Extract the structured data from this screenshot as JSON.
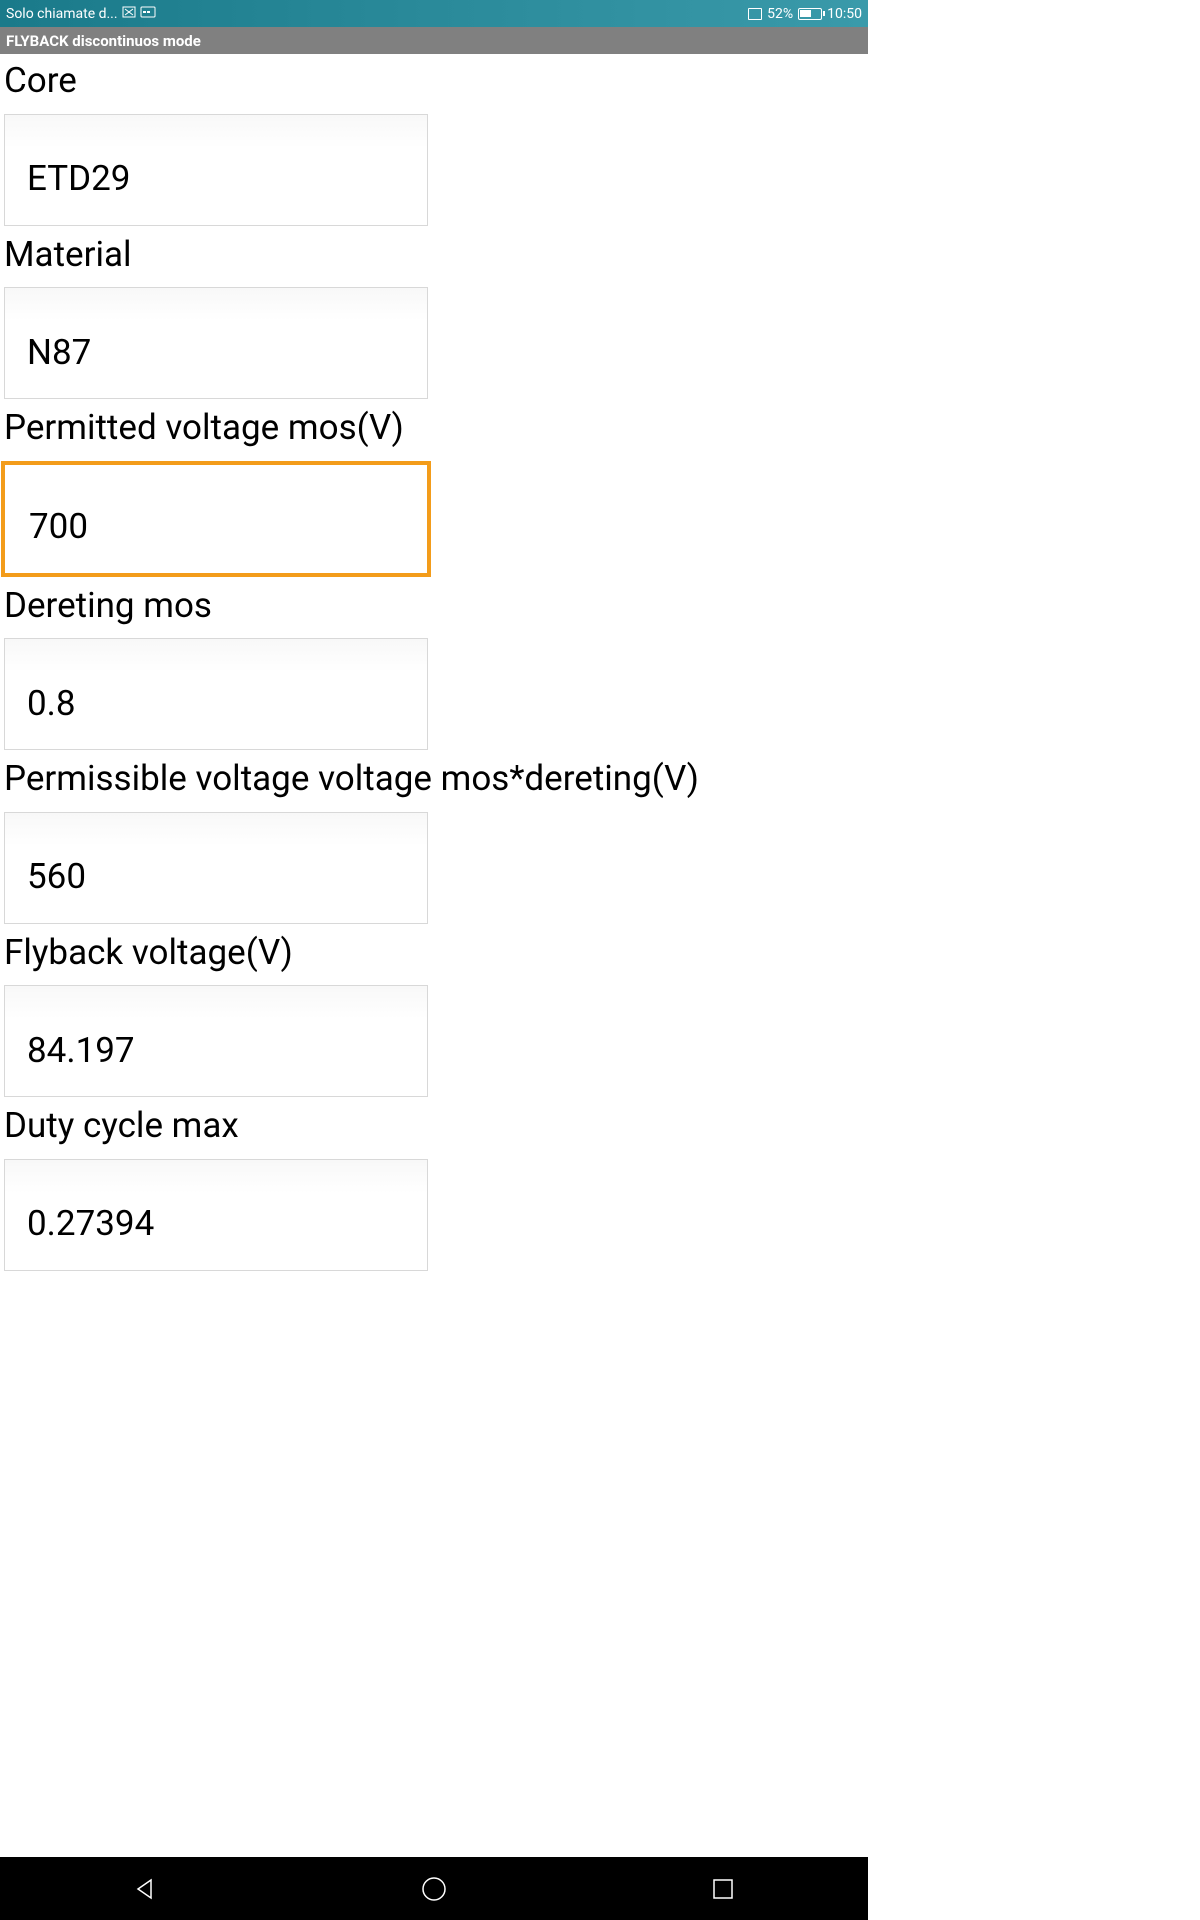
{
  "statusBar": {
    "leftText": "Solo chiamate d...",
    "batteryPercent": "52%",
    "time": "10:50"
  },
  "appTitle": "FLYBACK discontinuos mode",
  "fields": [
    {
      "label": "Core",
      "value": "ETD29",
      "focused": false
    },
    {
      "label": "Material",
      "value": "N87",
      "focused": false
    },
    {
      "label": "Permitted voltage mos(V)",
      "value": "700",
      "focused": true
    },
    {
      "label": "Dereting mos",
      "value": "0.8",
      "focused": false
    },
    {
      "label": "Permissible voltage voltage mos*dereting(V)",
      "value": "560",
      "focused": false
    },
    {
      "label": "Flyback voltage(V)",
      "value": "84.197",
      "focused": false
    },
    {
      "label": "Duty cycle max",
      "value": "0.27394",
      "focused": false
    }
  ]
}
